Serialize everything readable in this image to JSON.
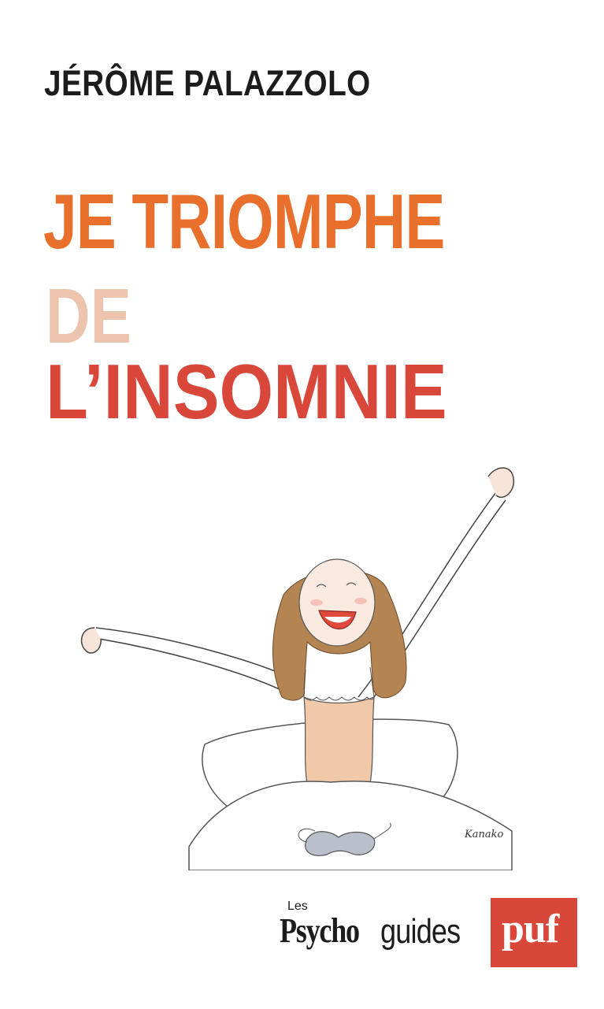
{
  "cover": {
    "author": "JÉRÔME PALAZZOLO",
    "title_line1": "JE TRIOMPHE",
    "title_line2": "DE",
    "title_line3": "L’INSOMNIE",
    "illustration_signature": "Kanako",
    "series_prefix": "Les",
    "series_name_bold": "Psycho",
    "series_name_light": "guides",
    "publisher": "puf"
  },
  "colors": {
    "author": "#1c1c1c",
    "title_orange": "#e8702c",
    "title_peach": "#ecc4ae",
    "title_red": "#d9473a",
    "publisher_bg": "#d9473a"
  }
}
